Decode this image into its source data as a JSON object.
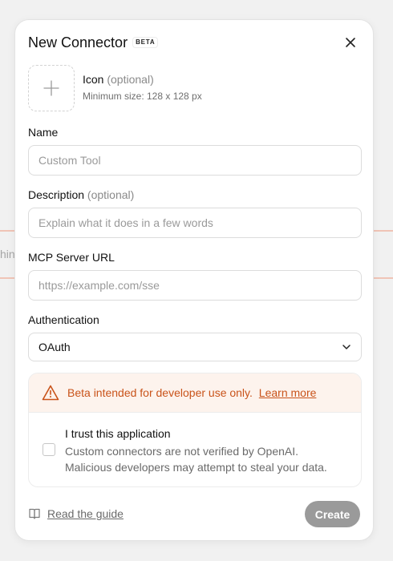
{
  "background": {
    "fragment_text": "hin"
  },
  "modal": {
    "title": "New Connector",
    "beta_tag": "BETA",
    "icon": {
      "label": "Icon",
      "optional": "(optional)",
      "hint": "Minimum size: 128 x 128 px"
    },
    "name": {
      "label": "Name",
      "placeholder": "Custom Tool",
      "value": ""
    },
    "description": {
      "label": "Description",
      "optional": "(optional)",
      "placeholder": "Explain what it does in a few words",
      "value": ""
    },
    "url": {
      "label": "MCP Server URL",
      "placeholder": "https://example.com/sse",
      "value": ""
    },
    "auth": {
      "label": "Authentication",
      "selected": "OAuth"
    },
    "warning": {
      "text": "Beta intended for developer use only.",
      "link": "Learn more",
      "color": "#c9531a"
    },
    "trust": {
      "title": "I trust this application",
      "line1": "Custom connectors are not verified by OpenAI.",
      "line2": "Malicious developers may attempt to steal your data."
    },
    "footer": {
      "guide": "Read the guide",
      "create": "Create"
    }
  },
  "icons": [
    "close-icon",
    "plus-icon",
    "chevron-down-icon",
    "warning-icon",
    "book-icon"
  ]
}
